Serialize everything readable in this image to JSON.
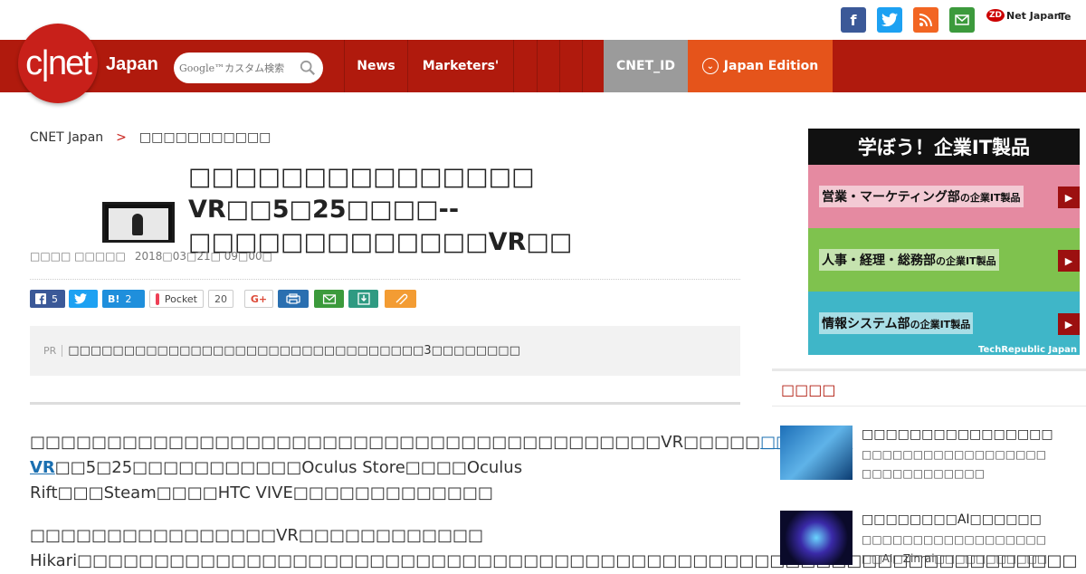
{
  "social": {
    "facebook": "f",
    "twitter": "t",
    "rss": "rss",
    "mail": "mail",
    "zdnet_logo": "ZD",
    "zdnet_label": "Net Japan",
    "tech_label": "Te"
  },
  "header": {
    "logo_text": "c|net",
    "logo_japan": "Japan",
    "search_placeholder": "Google™カスタム検索",
    "nav": {
      "news": "News",
      "marketers": "Marketers'",
      "cnet_id": "CNET_ID",
      "edition": "Japan Edition"
    }
  },
  "breadcrumb": {
    "home": "CNET Japan",
    "sep": ">",
    "section": "□□□□□□□□□□□"
  },
  "article": {
    "title": "□□□□□□□□□□□□□□□ VR□□5□25□□□□--□□□□□□□□□□□□□VR□□",
    "author": "□□□□ □□□□□",
    "date": "2018□03□21□ 09□00□",
    "share": {
      "fb_count": "5",
      "tw": "",
      "hb": "B!",
      "hb_count": "2",
      "pocket": "Pocket",
      "pocket_count": "20",
      "gplus": "G+"
    },
    "pr_label": "PR",
    "pr_text": "□□□□□□□□□□□□□□□□□□□□□□□□□□□□□□□□3□□□□□□□□",
    "body1_a": "□□□□□□□□□□□□□□□□□□□□□□□□□□□□□□□□□□□□□□□□□VR□□□□□",
    "body1_link": "□□□□□□ VR",
    "body1_b": "□□5□25□□□□□□□□□□□Oculus Store□□□□Oculus Rift□□□Steam□□□□HTC VIVE□□□□□□□□□□□□□",
    "body2": "□□□□□□□□□□□□□□□□VR□□□□□□□□□□□□ Hikari□□□□□□□□□□□□□□□□□□□□□□□□□□□□□□□□□□□□□□□□□□□□□□□□□□□□□□□□□□□□□□□□□"
  },
  "ad": {
    "headline": "学ぼう！企業IT製品",
    "row1": "営業・マーケティング部",
    "row1_suffix": "の企業IT製品",
    "row2": "人事・経理・総務部",
    "row2_suffix": "の企業IT製品",
    "row3": "情報システム部",
    "row3_suffix": "の企業IT製品",
    "footer": "TechRepublic Japan"
  },
  "sidebar": {
    "title": "□□□□",
    "items": [
      {
        "headline": "□□□□□□□□□□□□□□□□",
        "desc1": "□□□□□□□□□□□□□□□□□□",
        "desc2": "□□□□□□□□□□□□"
      },
      {
        "headline": "□□□□□□□□AI□□□□□□",
        "desc1": "□□□□□□□□□□□□□□□□□□",
        "desc2": "□□AI□Zinrai□□□□□□□□□□□"
      }
    ]
  }
}
